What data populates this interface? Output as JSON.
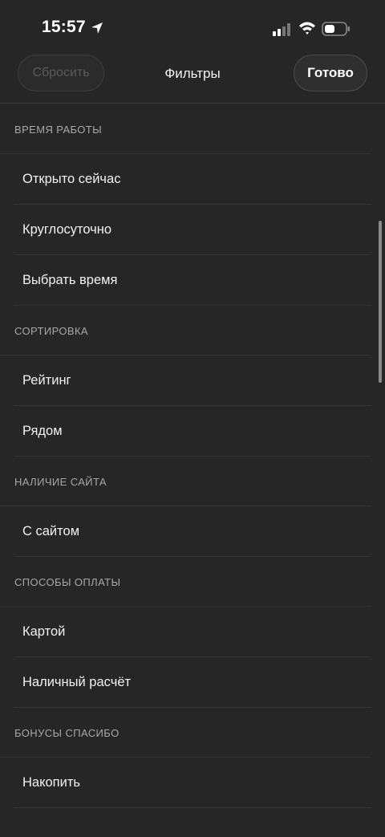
{
  "status_bar": {
    "time": "15:57"
  },
  "nav": {
    "reset_label": "Сбросить",
    "title": "Фильтры",
    "done_label": "Готово"
  },
  "sections": [
    {
      "title": "ВРЕМЯ РАБОТЫ",
      "items": [
        "Открыто сейчас",
        "Круглосуточно",
        "Выбрать время"
      ]
    },
    {
      "title": "СОРТИРОВКА",
      "items": [
        "Рейтинг",
        "Рядом"
      ]
    },
    {
      "title": "НАЛИЧИЕ САЙТА",
      "items": [
        "С сайтом"
      ]
    },
    {
      "title": "СПОСОБЫ ОПЛАТЫ",
      "items": [
        "Картой",
        "Наличный расчёт"
      ]
    },
    {
      "title": "БОНУСЫ СПАСИБО",
      "items": [
        "Накопить"
      ]
    }
  ],
  "colors": {
    "background": "#262626",
    "text": "#f2f2f2",
    "section_header": "#a8a8a8"
  }
}
